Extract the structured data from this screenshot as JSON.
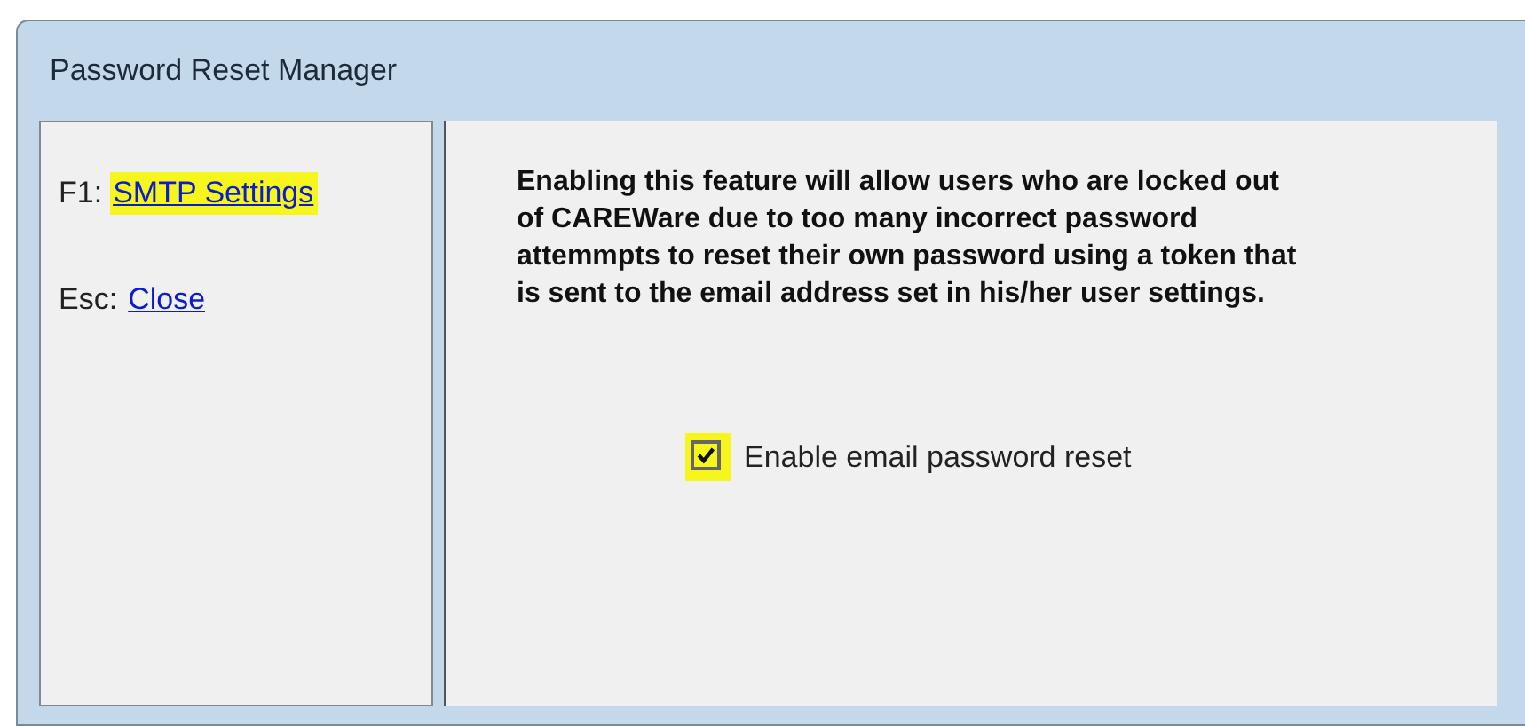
{
  "window": {
    "title": "Password Reset Manager"
  },
  "shortcuts": [
    {
      "key": "F1:",
      "label": "SMTP Settings",
      "highlighted": true
    },
    {
      "key": "Esc:",
      "label": "Close",
      "highlighted": false
    }
  ],
  "description": "Enabling this feature will allow users who are locked out of CAREWare due to too many incorrect password attemmpts to reset their own password using a token that is sent to the email address set in his/her user settings.",
  "option": {
    "label": "Enable email password reset",
    "checked": true,
    "highlighted": true
  }
}
